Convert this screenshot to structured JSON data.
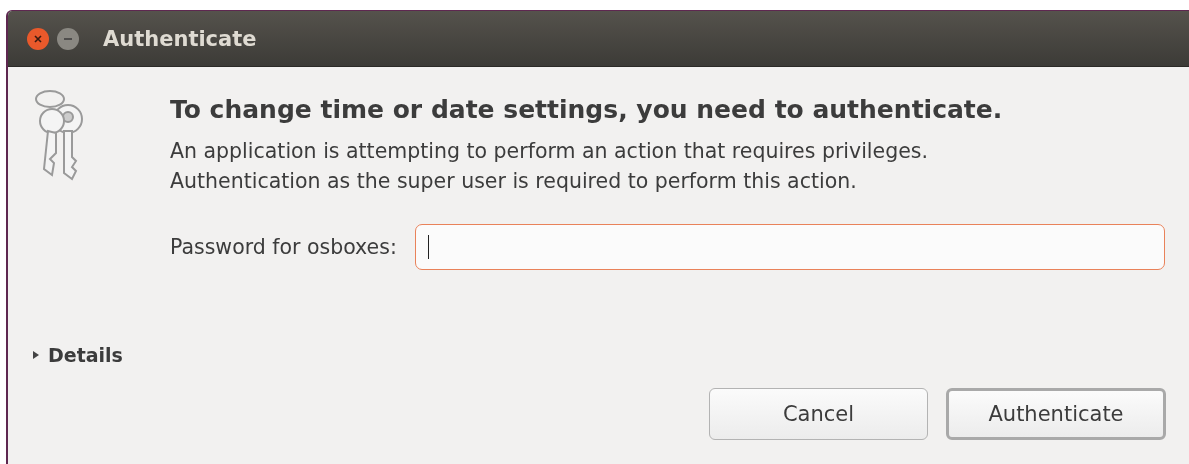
{
  "window": {
    "title": "Authenticate"
  },
  "heading": "To change time or date settings, you need to authenticate.",
  "message": [
    "An application is attempting to perform an action that requires privileges.",
    "Authentication as the super user is required to perform this action."
  ],
  "password": {
    "label": "Password for osboxes:",
    "focused": true
  },
  "details": {
    "label": "Details",
    "expanded": false
  },
  "buttons": [
    {
      "label": "Cancel",
      "default": false
    },
    {
      "label": "Authenticate",
      "default": true
    }
  ]
}
